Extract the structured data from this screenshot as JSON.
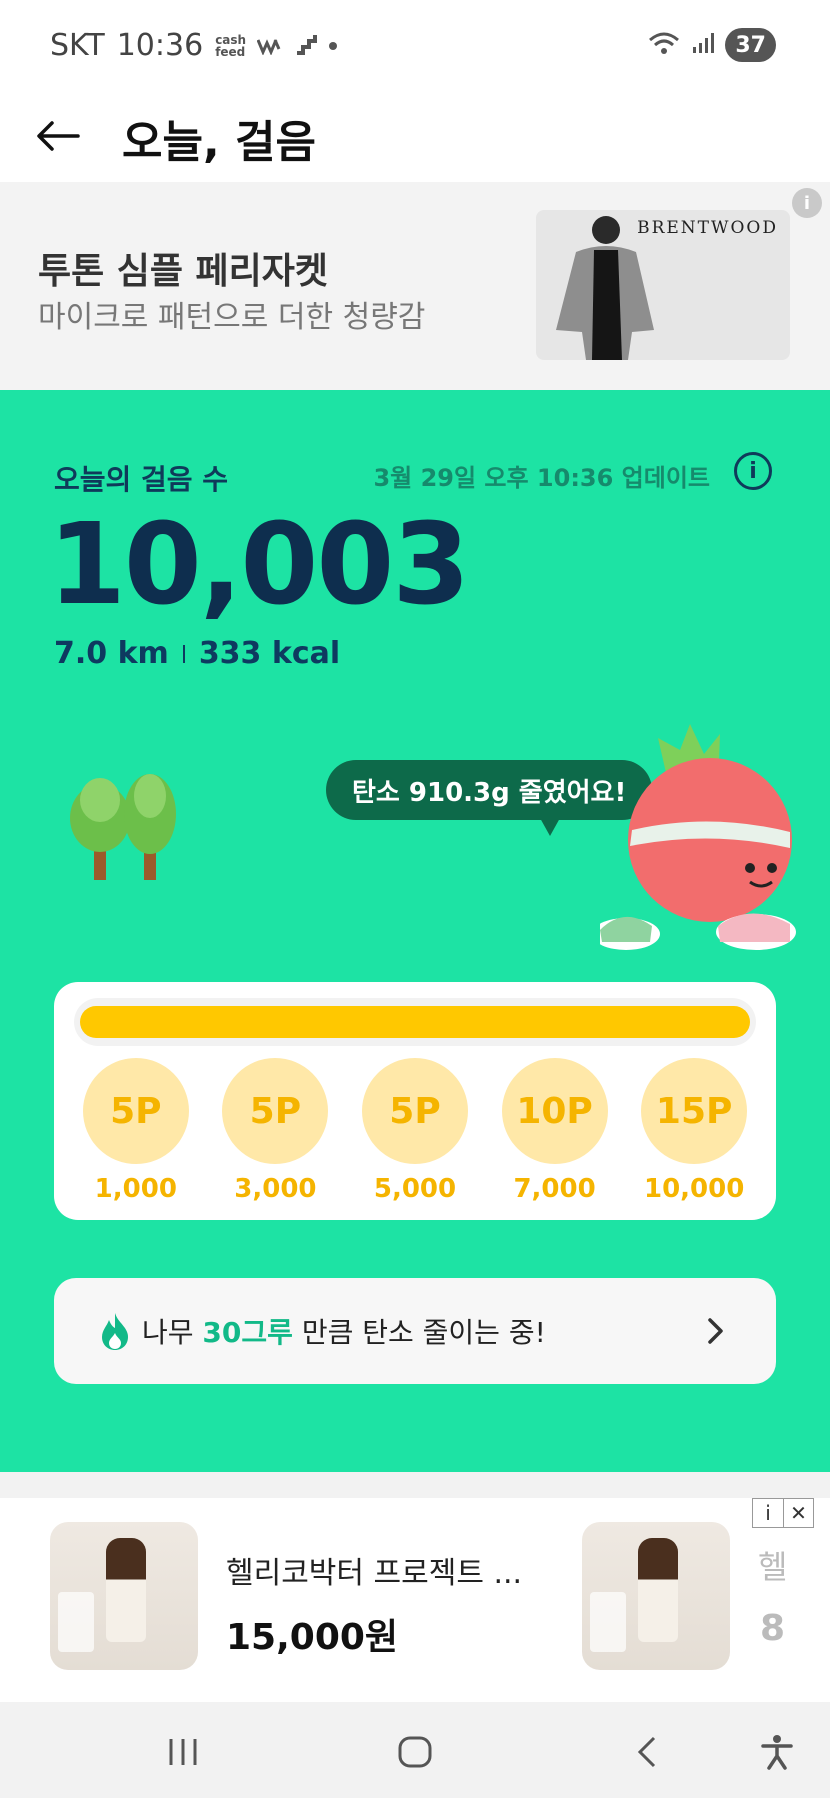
{
  "status_bar": {
    "carrier": "SKT",
    "time": "10:36",
    "app_badge": "cash feed",
    "battery": "37"
  },
  "header": {
    "title": "오늘, 걸음"
  },
  "ad_banner": {
    "title": "투톤 심플 페리자켓",
    "subtitle": "마이크로 패턴으로 더한 청량감",
    "brand": "BRENTWOOD",
    "info": "i"
  },
  "steps": {
    "label": "오늘의 걸음 수",
    "update_text": "3월 29일 오후 10:36 업데이트",
    "count": "10,003",
    "distance": "7.0 km",
    "calories": "333 kcal",
    "carbon_message": "탄소 910.3g 줄였어요!"
  },
  "progress": {
    "fill_fraction": 1.0,
    "fill_color": "#ffc800",
    "rewards": [
      {
        "points": "5P",
        "steps": "1,000"
      },
      {
        "points": "5P",
        "steps": "3,000"
      },
      {
        "points": "5P",
        "steps": "5,000"
      },
      {
        "points": "10P",
        "steps": "7,000"
      },
      {
        "points": "15P",
        "steps": "10,000"
      }
    ]
  },
  "tree_card": {
    "prefix": "나무 ",
    "highlight": "30그루",
    "suffix": " 만큼 탄소 줄이는 중!",
    "icon": "fire-icon"
  },
  "product_ad": {
    "name": "헬리코박터 프로젝트 ...",
    "price": "15,000원",
    "next_name_partial": "헬",
    "next_price_partial": "8",
    "info": "i",
    "close": "✕"
  },
  "colors": {
    "primary_green": "#1de3a4",
    "navy": "#0e2e4e",
    "coin": "#f5b400"
  }
}
